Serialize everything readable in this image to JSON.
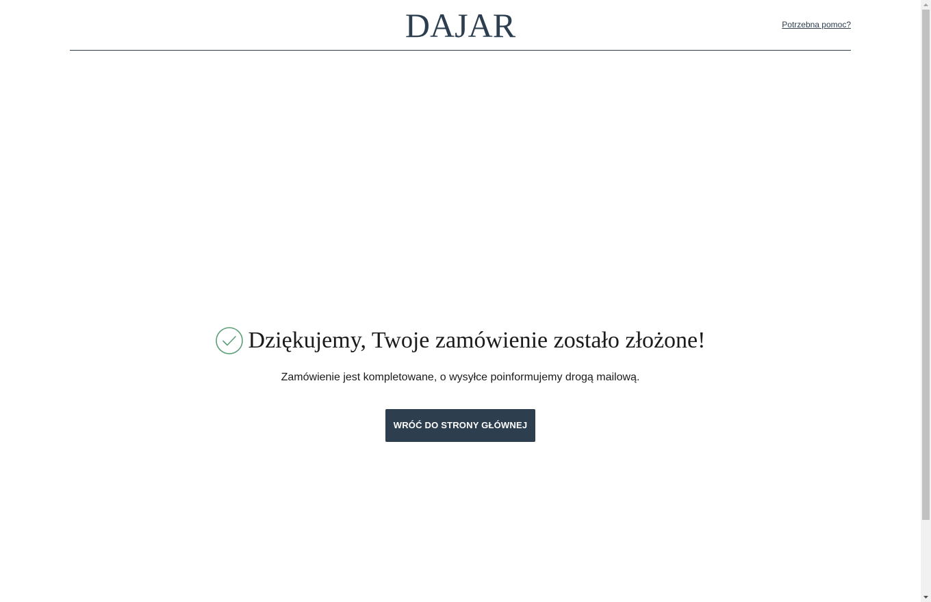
{
  "header": {
    "logo_text": "DAJAR",
    "help_link": "Potrzebna pomoc?"
  },
  "confirmation": {
    "icon": "check-circle-icon",
    "title": "Dziękujemy, Twoje zamówienie zostało złożone!",
    "message": "Zamówienie jest kompletowane, o wysyłce poinformujemy drogą mailową.",
    "button_label": "WRÓĆ DO STRONY GŁÓWNEJ"
  },
  "colors": {
    "brand": "#2c3e50",
    "button_bg": "#2d3e4e",
    "check_green": "#5a9e78"
  }
}
